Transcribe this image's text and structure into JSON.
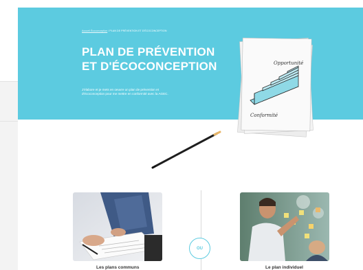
{
  "hero": {
    "breadcrumb_link": "Accueil Écoconception",
    "breadcrumb_sep": "/",
    "breadcrumb_current": "PLAN DE PRÉVENTION ET D'ÉCOCONCEPTION",
    "title_line1": "PLAN DE PRÉVENTION",
    "title_line2": "ET D'ÉCOCONCEPTION",
    "description": "J'élabore et je mets en oeuvre un plan de prévention et d'écoconception pour me mettre en conformité avec la AGEC."
  },
  "illustration": {
    "paper_top_label": "Opportunité",
    "paper_bottom_label": "Conformité"
  },
  "cards": {
    "left_label": "Les plans communs",
    "right_label": "Le plan individuel",
    "separator_label": "OU"
  },
  "colors": {
    "accent": "#5ccbe0",
    "stairs": "#8fd9e6"
  }
}
